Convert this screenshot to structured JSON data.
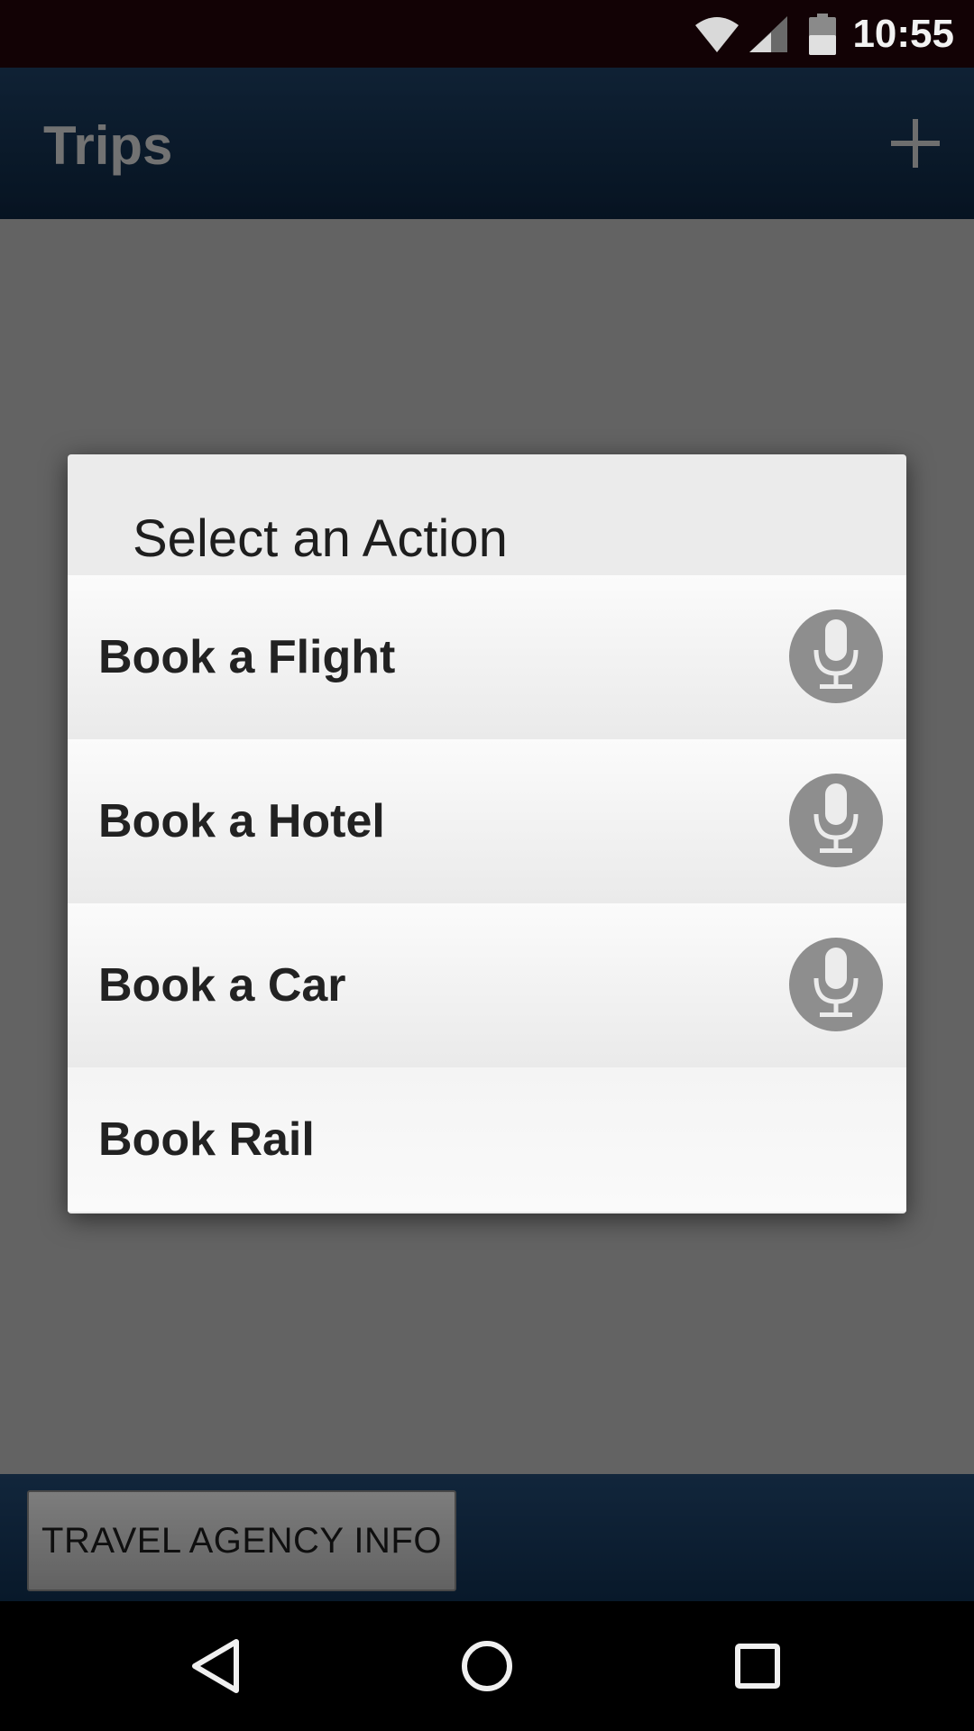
{
  "status_bar": {
    "time": "10:55",
    "icons": [
      "wifi-icon",
      "cell-signal-icon",
      "battery-icon"
    ]
  },
  "app_bar": {
    "title": "Trips",
    "add_icon": "plus-icon"
  },
  "bottom_bar": {
    "agency_button_label": "TRAVEL AGENCY INFO"
  },
  "dialog": {
    "title": "Select an Action",
    "actions": [
      {
        "label": "Book a Flight",
        "icon": "microphone-icon"
      },
      {
        "label": "Book a Hotel",
        "icon": "microphone-icon"
      },
      {
        "label": "Book a Car",
        "icon": "microphone-icon"
      },
      {
        "label": "Book Rail"
      }
    ]
  },
  "nav_bar": {
    "icons": [
      "back-icon",
      "home-icon",
      "recents-icon"
    ]
  },
  "colors": {
    "status_bar": "#120205",
    "app_bar": "#1b3a5b",
    "content": "#ababab",
    "dialog": "#ebebeb",
    "mic_button": "#8e8e8e"
  }
}
